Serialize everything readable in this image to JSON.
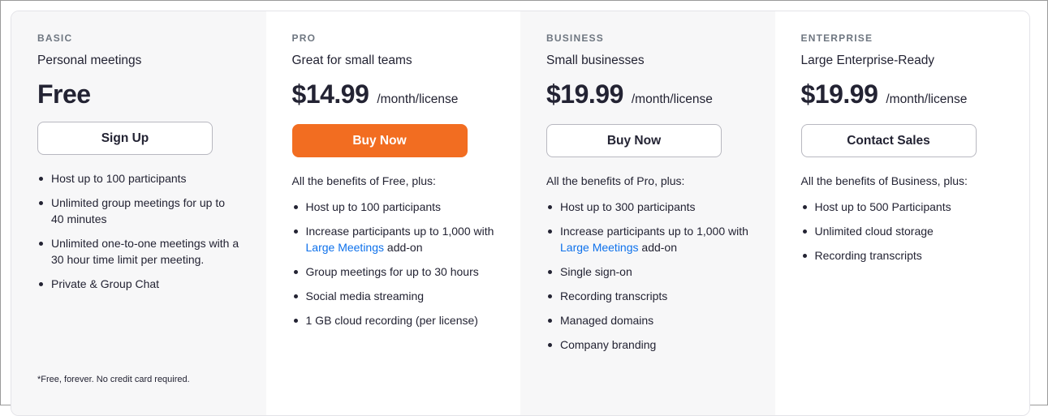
{
  "plans": {
    "basic": {
      "tier": "BASIC",
      "tagline": "Personal meetings",
      "price": "Free",
      "button": "Sign Up",
      "features": [
        "Host up to 100 participants",
        "Unlimited group meetings for up to 40 minutes",
        "Unlimited one-to-one meetings with a 30 hour time limit per meeting.",
        "Private & Group Chat"
      ],
      "footnote": "*Free, forever. No credit card required."
    },
    "pro": {
      "tier": "PRO",
      "tagline": "Great for small teams",
      "price": "$14.99",
      "unit": "/month/license",
      "button": "Buy Now",
      "intro": "All the benefits of Free, plus:",
      "features": [
        "Host up to 100 participants",
        "Increase participants up to 1,000 with",
        "Group meetings for up to 30 hours",
        "Social media streaming",
        "1 GB cloud recording (per license)"
      ],
      "addon_link": "Large Meetings",
      "addon_suffix": "add-on"
    },
    "business": {
      "tier": "BUSINESS",
      "tagline": "Small businesses",
      "price": "$19.99",
      "unit": "/month/license",
      "button": "Buy Now",
      "intro": "All the benefits of Pro, plus:",
      "features": [
        "Host up to 300 participants",
        "Increase participants up to 1,000 with",
        "Single sign-on",
        "Recording transcripts",
        "Managed domains",
        "Company branding"
      ],
      "addon_link": "Large Meetings",
      "addon_suffix": "add-on"
    },
    "enterprise": {
      "tier": "ENTERPRISE",
      "tagline": "Large Enterprise-Ready",
      "price": "$19.99",
      "unit": "/month/license",
      "button": "Contact Sales",
      "intro": "All the benefits of Business, plus:",
      "features": [
        "Host up to 500 Participants",
        "Unlimited cloud storage",
        "Recording transcripts"
      ]
    }
  },
  "colors": {
    "accent": "#f26d21",
    "link": "#0e71eb",
    "text": "#232333",
    "tier_label": "#6e7680",
    "shaded_column": "#f7f7f8"
  }
}
